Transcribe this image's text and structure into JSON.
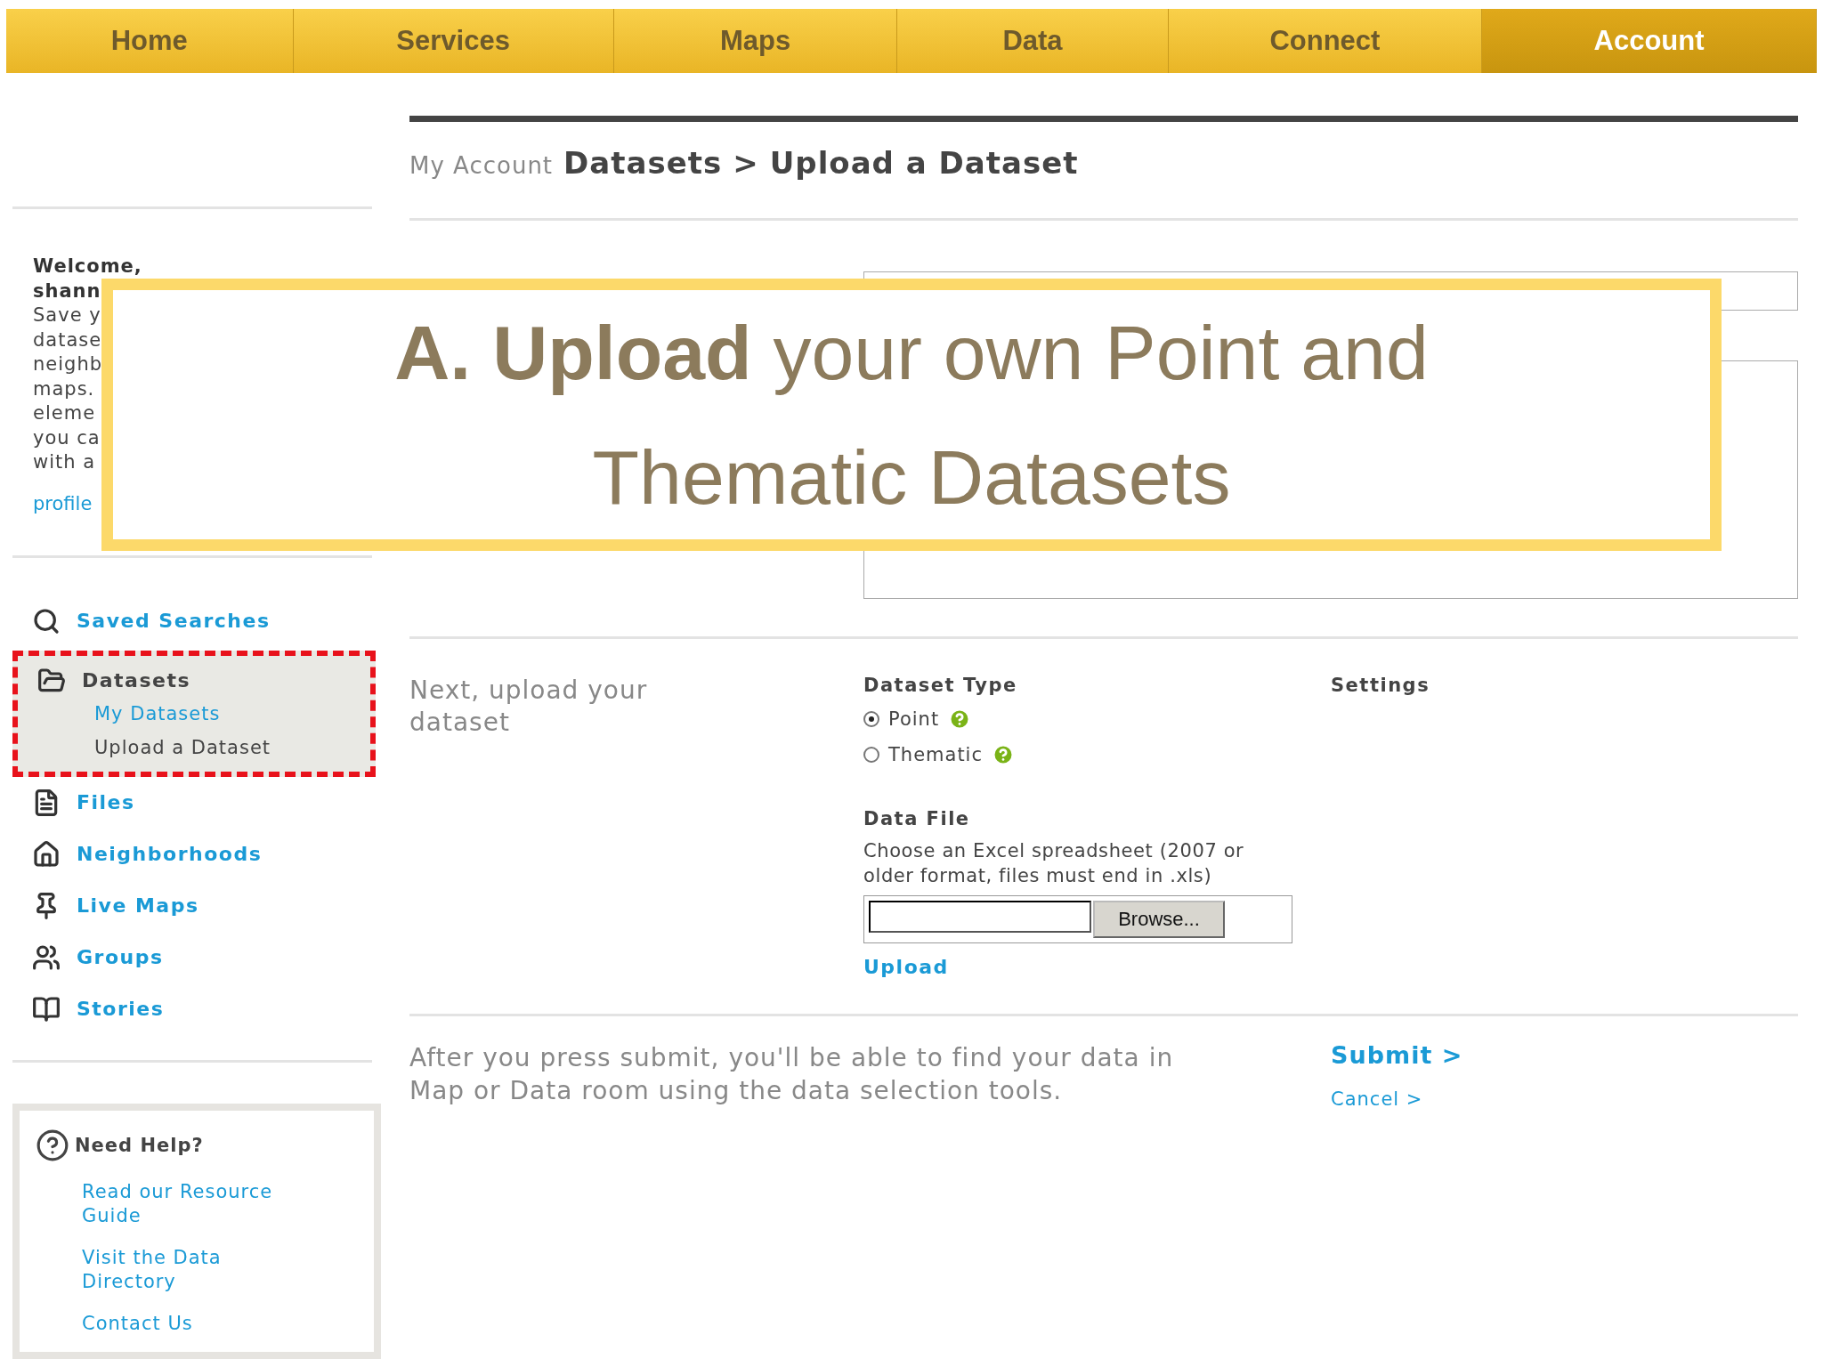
{
  "nav": [
    {
      "label": "Home",
      "selected": false
    },
    {
      "label": "Services",
      "selected": false
    },
    {
      "label": "Maps",
      "selected": false
    },
    {
      "label": "Data",
      "selected": false
    },
    {
      "label": "Connect",
      "selected": false
    },
    {
      "label": "Account",
      "selected": true
    }
  ],
  "sidebar": {
    "welcome": {
      "title_lines": [
        "Welcome,",
        "shann"
      ],
      "text_lines": [
        "Save y",
        "datase",
        "neighb",
        "maps.",
        "eleme",
        "you ca",
        "with a"
      ],
      "link": "profile"
    },
    "items": [
      {
        "label": "Saved Searches",
        "selected": false,
        "highlighted": false
      },
      {
        "label": "Datasets",
        "selected": true,
        "highlighted": true,
        "children": [
          {
            "label": "My Datasets",
            "selected": false
          },
          {
            "label": "Upload a Dataset",
            "selected": true
          }
        ]
      },
      {
        "label": "Files",
        "selected": false,
        "highlighted": false
      },
      {
        "label": "Neighborhoods",
        "selected": false,
        "highlighted": false
      },
      {
        "label": "Live Maps",
        "selected": false,
        "highlighted": false
      },
      {
        "label": "Groups",
        "selected": false,
        "highlighted": false
      },
      {
        "label": "Stories",
        "selected": false,
        "highlighted": false
      }
    ],
    "help": {
      "title": "Need Help?",
      "links": [
        "Read our Resource Guide",
        "Visit the Data Directory",
        "Contact Us"
      ]
    }
  },
  "breadcrumb": {
    "parent": "My Account",
    "section": "Datasets",
    "separator": ">",
    "page": "Upload a Dataset"
  },
  "upload": {
    "intro": "Next, upload your dataset",
    "type_label": "Dataset Type",
    "types": [
      {
        "label": "Point",
        "selected": true
      },
      {
        "label": "Thematic",
        "selected": false
      }
    ],
    "settings_label": "Settings",
    "file_label": "Data File",
    "file_hint": "Choose an Excel spreadsheet (2007 or older format, files must end in .xls)",
    "browse": "Browse...",
    "upload_link": "Upload"
  },
  "footer": {
    "note": "After you press submit, you'll be able to find your data in Map or Data room using the data selection tools.",
    "submit": "Submit >",
    "cancel": "Cancel >"
  },
  "callout": {
    "lines": [
      "**A. Upload** your own Point and",
      "Thematic Datasets"
    ]
  }
}
